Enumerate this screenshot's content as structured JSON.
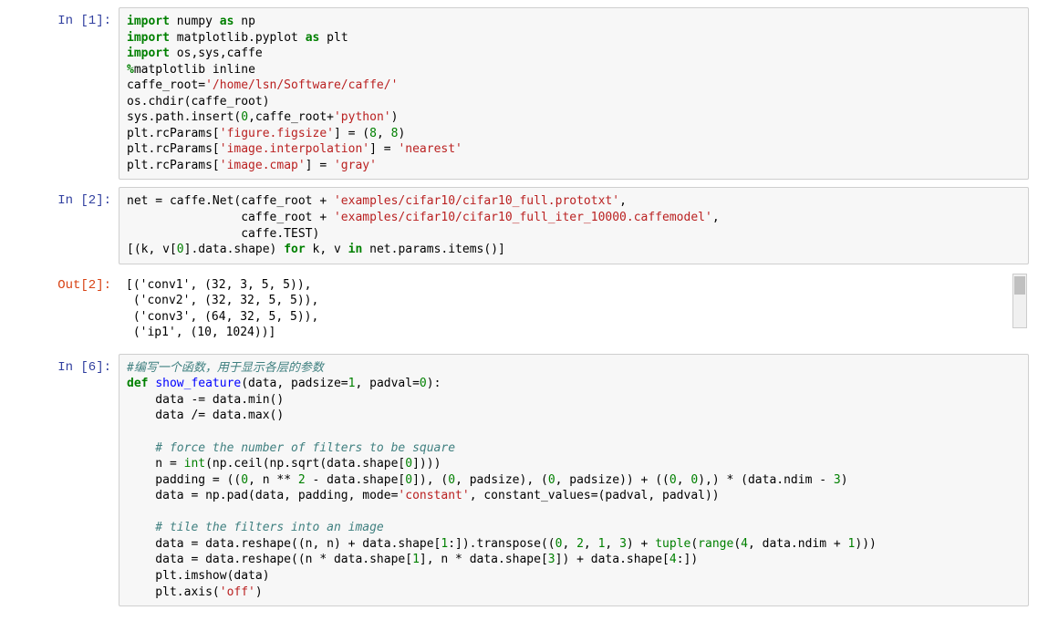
{
  "cells": [
    {
      "type": "code",
      "prompt_in": "In [1]:",
      "tokens": [
        {
          "t": "import",
          "c": "kw"
        },
        {
          "t": " numpy ",
          "c": "nm"
        },
        {
          "t": "as",
          "c": "as"
        },
        {
          "t": " np\n",
          "c": "nm"
        },
        {
          "t": "import",
          "c": "kw"
        },
        {
          "t": " matplotlib.pyplot ",
          "c": "nm"
        },
        {
          "t": "as",
          "c": "as"
        },
        {
          "t": " plt\n",
          "c": "nm"
        },
        {
          "t": "import",
          "c": "kw"
        },
        {
          "t": " os,sys,caffe\n",
          "c": "nm"
        },
        {
          "t": "%",
          "c": "magic"
        },
        {
          "t": "matplotlib",
          "c": "nm"
        },
        {
          "t": " inline\n",
          "c": "nm"
        },
        {
          "t": "caffe_root=",
          "c": "nm"
        },
        {
          "t": "'/home/lsn/Software/caffe/'",
          "c": "str"
        },
        {
          "t": "\n",
          "c": "nm"
        },
        {
          "t": "os.chdir(caffe_root)\n",
          "c": "nm"
        },
        {
          "t": "sys.path.insert(",
          "c": "nm"
        },
        {
          "t": "0",
          "c": "num"
        },
        {
          "t": ",caffe_root+",
          "c": "nm"
        },
        {
          "t": "'python'",
          "c": "str"
        },
        {
          "t": ")\n",
          "c": "nm"
        },
        {
          "t": "plt.rcParams[",
          "c": "nm"
        },
        {
          "t": "'figure.figsize'",
          "c": "str"
        },
        {
          "t": "] = (",
          "c": "nm"
        },
        {
          "t": "8",
          "c": "num"
        },
        {
          "t": ", ",
          "c": "nm"
        },
        {
          "t": "8",
          "c": "num"
        },
        {
          "t": ")\n",
          "c": "nm"
        },
        {
          "t": "plt.rcParams[",
          "c": "nm"
        },
        {
          "t": "'image.interpolation'",
          "c": "str"
        },
        {
          "t": "] = ",
          "c": "nm"
        },
        {
          "t": "'nearest'",
          "c": "str"
        },
        {
          "t": "\n",
          "c": "nm"
        },
        {
          "t": "plt.rcParams[",
          "c": "nm"
        },
        {
          "t": "'image.cmap'",
          "c": "str"
        },
        {
          "t": "] = ",
          "c": "nm"
        },
        {
          "t": "'gray'",
          "c": "str"
        }
      ]
    },
    {
      "type": "code",
      "prompt_in": "In [2]:",
      "prompt_out": "Out[2]:",
      "tokens": [
        {
          "t": "net = caffe.Net(caffe_root + ",
          "c": "nm"
        },
        {
          "t": "'examples/cifar10/cifar10_full.prototxt'",
          "c": "str"
        },
        {
          "t": ",\n",
          "c": "nm"
        },
        {
          "t": "                caffe_root + ",
          "c": "nm"
        },
        {
          "t": "'examples/cifar10/cifar10_full_iter_10000.caffemodel'",
          "c": "str"
        },
        {
          "t": ",\n",
          "c": "nm"
        },
        {
          "t": "                caffe.TEST)\n",
          "c": "nm"
        },
        {
          "t": "[(k, v[",
          "c": "nm"
        },
        {
          "t": "0",
          "c": "num"
        },
        {
          "t": "].data.shape) ",
          "c": "nm"
        },
        {
          "t": "for",
          "c": "kw"
        },
        {
          "t": " k, v ",
          "c": "nm"
        },
        {
          "t": "in",
          "c": "kw"
        },
        {
          "t": " net.params.items()]",
          "c": "nm"
        }
      ],
      "output": "[('conv1', (32, 3, 5, 5)),\n ('conv2', (32, 32, 5, 5)),\n ('conv3', (64, 32, 5, 5)),\n ('ip1', (10, 1024))]"
    },
    {
      "type": "code",
      "prompt_in": "In [6]:",
      "tokens": [
        {
          "t": "#编写一个函数，用于显示各层的参数\n",
          "c": "comment"
        },
        {
          "t": "def",
          "c": "kw"
        },
        {
          "t": " ",
          "c": "nm"
        },
        {
          "t": "show_feature",
          "c": "fn"
        },
        {
          "t": "(data, padsize=",
          "c": "nm"
        },
        {
          "t": "1",
          "c": "num"
        },
        {
          "t": ", padval=",
          "c": "nm"
        },
        {
          "t": "0",
          "c": "num"
        },
        {
          "t": "):\n",
          "c": "nm"
        },
        {
          "t": "    data -= data.min()\n",
          "c": "nm"
        },
        {
          "t": "    data /= data.max()\n",
          "c": "nm"
        },
        {
          "t": "    \n",
          "c": "nm"
        },
        {
          "t": "    # force the number of filters to be square\n",
          "c": "comment"
        },
        {
          "t": "    n = ",
          "c": "nm"
        },
        {
          "t": "int",
          "c": "builtin"
        },
        {
          "t": "(np.ceil(np.sqrt(data.shape[",
          "c": "nm"
        },
        {
          "t": "0",
          "c": "num"
        },
        {
          "t": "])))\n",
          "c": "nm"
        },
        {
          "t": "    padding = ((",
          "c": "nm"
        },
        {
          "t": "0",
          "c": "num"
        },
        {
          "t": ", n ** ",
          "c": "nm"
        },
        {
          "t": "2",
          "c": "num"
        },
        {
          "t": " - data.shape[",
          "c": "nm"
        },
        {
          "t": "0",
          "c": "num"
        },
        {
          "t": "]), (",
          "c": "nm"
        },
        {
          "t": "0",
          "c": "num"
        },
        {
          "t": ", padsize), (",
          "c": "nm"
        },
        {
          "t": "0",
          "c": "num"
        },
        {
          "t": ", padsize)) + ((",
          "c": "nm"
        },
        {
          "t": "0",
          "c": "num"
        },
        {
          "t": ", ",
          "c": "nm"
        },
        {
          "t": "0",
          "c": "num"
        },
        {
          "t": "),) * (data.ndim - ",
          "c": "nm"
        },
        {
          "t": "3",
          "c": "num"
        },
        {
          "t": ")\n",
          "c": "nm"
        },
        {
          "t": "    data = np.pad(data, padding, mode=",
          "c": "nm"
        },
        {
          "t": "'constant'",
          "c": "str"
        },
        {
          "t": ", constant_values=(padval, padval))\n",
          "c": "nm"
        },
        {
          "t": "    \n",
          "c": "nm"
        },
        {
          "t": "    # tile the filters into an image\n",
          "c": "comment"
        },
        {
          "t": "    data = data.reshape((n, n) + data.shape[",
          "c": "nm"
        },
        {
          "t": "1",
          "c": "num"
        },
        {
          "t": ":]).transpose((",
          "c": "nm"
        },
        {
          "t": "0",
          "c": "num"
        },
        {
          "t": ", ",
          "c": "nm"
        },
        {
          "t": "2",
          "c": "num"
        },
        {
          "t": ", ",
          "c": "nm"
        },
        {
          "t": "1",
          "c": "num"
        },
        {
          "t": ", ",
          "c": "nm"
        },
        {
          "t": "3",
          "c": "num"
        },
        {
          "t": ") + ",
          "c": "nm"
        },
        {
          "t": "tuple",
          "c": "builtin"
        },
        {
          "t": "(",
          "c": "nm"
        },
        {
          "t": "range",
          "c": "builtin"
        },
        {
          "t": "(",
          "c": "nm"
        },
        {
          "t": "4",
          "c": "num"
        },
        {
          "t": ", data.ndim + ",
          "c": "nm"
        },
        {
          "t": "1",
          "c": "num"
        },
        {
          "t": ")))\n",
          "c": "nm"
        },
        {
          "t": "    data = data.reshape((n * data.shape[",
          "c": "nm"
        },
        {
          "t": "1",
          "c": "num"
        },
        {
          "t": "], n * data.shape[",
          "c": "nm"
        },
        {
          "t": "3",
          "c": "num"
        },
        {
          "t": "]) + data.shape[",
          "c": "nm"
        },
        {
          "t": "4",
          "c": "num"
        },
        {
          "t": ":])\n",
          "c": "nm"
        },
        {
          "t": "    plt.imshow(data)\n",
          "c": "nm"
        },
        {
          "t": "    plt.axis(",
          "c": "nm"
        },
        {
          "t": "'off'",
          "c": "str"
        },
        {
          "t": ")",
          "c": "nm"
        }
      ]
    }
  ]
}
